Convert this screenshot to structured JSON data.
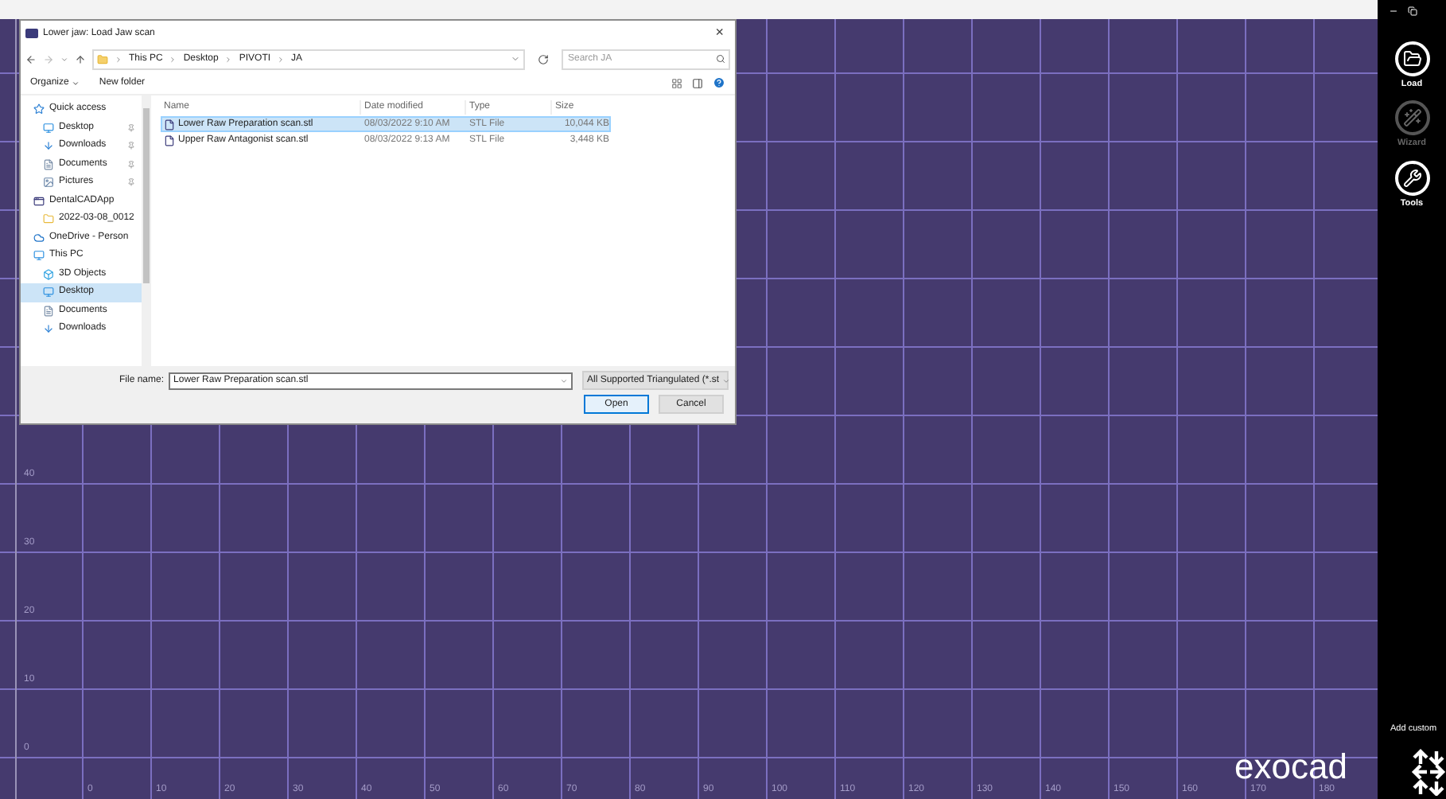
{
  "dialog": {
    "title": "Lower jaw: Load Jaw scan",
    "close": "×",
    "breadcrumb": [
      "This PC",
      "Desktop",
      "PIVOTI",
      "JA"
    ],
    "search": {
      "placeholder": "Search JA"
    },
    "organize": "Organize",
    "new_folder": "New folder",
    "nav": [
      {
        "label": "Quick access",
        "kind": "star",
        "selected": false,
        "children": [
          {
            "label": "Desktop",
            "kind": "desktop",
            "pinned": true,
            "selected": false
          },
          {
            "label": "Downloads",
            "kind": "download",
            "pinned": true,
            "selected": false
          },
          {
            "label": "Documents",
            "kind": "document",
            "pinned": true,
            "selected": false
          },
          {
            "label": "Pictures",
            "kind": "picture",
            "pinned": true,
            "selected": false
          }
        ]
      },
      {
        "label": "DentalCADApp",
        "kind": "app",
        "selected": false,
        "children": [
          {
            "label": "2022-03-08_0012",
            "kind": "folder",
            "pinned": false,
            "selected": false
          }
        ]
      },
      {
        "label": "OneDrive - Person",
        "kind": "cloud",
        "selected": false
      },
      {
        "label": "This PC",
        "kind": "pc",
        "selected": false,
        "children": [
          {
            "label": "3D Objects",
            "kind": "cube",
            "pinned": false,
            "selected": false
          },
          {
            "label": "Desktop",
            "kind": "desktop",
            "pinned": false,
            "selected": true
          },
          {
            "label": "Documents",
            "kind": "document",
            "pinned": false,
            "selected": false
          },
          {
            "label": "Downloads",
            "kind": "download",
            "pinned": false,
            "selected": false
          }
        ]
      }
    ],
    "columns": [
      "Name",
      "Date modified",
      "Type",
      "Size"
    ],
    "files": [
      {
        "name": "Lower Raw Preparation scan.stl",
        "date": "08/03/2022 9:10 AM",
        "type": "STL File",
        "size": "10,044 KB",
        "selected": true
      },
      {
        "name": "Upper Raw Antagonist scan.stl",
        "date": "08/03/2022 9:13 AM",
        "type": "STL File",
        "size": "3,448 KB",
        "selected": false
      }
    ],
    "file_name_label": "File name:",
    "file_name": "Lower Raw Preparation scan.stl",
    "filter": "All Supported Triangulated (*.st",
    "buttons": [
      "Open",
      "Cancel"
    ]
  },
  "canvas": {
    "x_labels": [
      "0",
      "10",
      "20",
      "30",
      "40",
      "50",
      "60",
      "70",
      "80",
      "90",
      "100",
      "110",
      "120",
      "130",
      "140",
      "150",
      "160",
      "170",
      "180"
    ],
    "y_labels": [
      "40",
      "30",
      "20",
      "10",
      "0"
    ],
    "logo": "exocad"
  },
  "sidebar": {
    "tools": [
      {
        "label": "Load",
        "kind": "load",
        "disabled": false
      },
      {
        "label": "Wizard",
        "kind": "wizard",
        "disabled": true
      },
      {
        "label": "Tools",
        "kind": "tools",
        "disabled": false
      }
    ],
    "add_custom": "Add custom"
  }
}
